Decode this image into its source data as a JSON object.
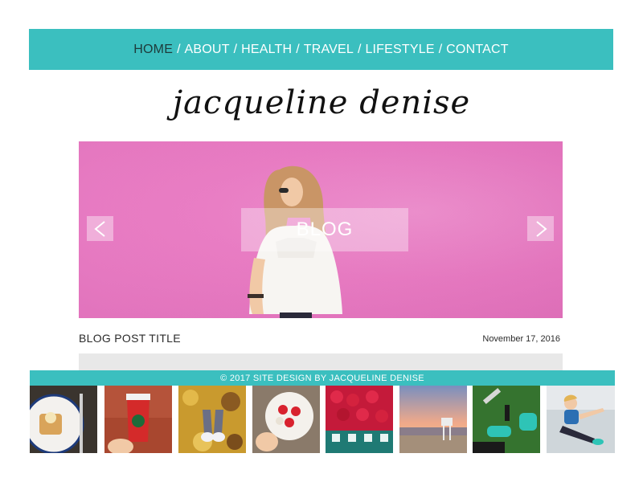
{
  "nav": {
    "items": [
      {
        "label": "HOME"
      },
      {
        "label": "ABOUT"
      },
      {
        "label": "HEALTH"
      },
      {
        "label": "TRAVEL"
      },
      {
        "label": "LIFESTYLE"
      },
      {
        "label": "CONTACT"
      }
    ],
    "separator": "/",
    "active_item": "HOME"
  },
  "logo": {
    "text": "jacqueline denise"
  },
  "hero": {
    "label": "BLOG",
    "prev_icon": "chevron-left-icon",
    "next_icon": "chevron-right-icon"
  },
  "post": {
    "title": "BLOG POST TITLE",
    "date": "November 17, 2016"
  },
  "footer": {
    "text": "© 2017 SITE DESIGN BY JACQUELINE DENISE"
  },
  "instagram": {
    "thumbnails": [
      "waffles",
      "starbucks-cup",
      "sneakers-leaves",
      "strawberry-bowl",
      "raspberries",
      "beach-sunset",
      "dumbbells-sneakers",
      "yoga-stretch"
    ]
  },
  "colors": {
    "accent": "#3bbfbf",
    "hero_pink": "#ea79c3",
    "active_nav": "#1e3b3b"
  }
}
